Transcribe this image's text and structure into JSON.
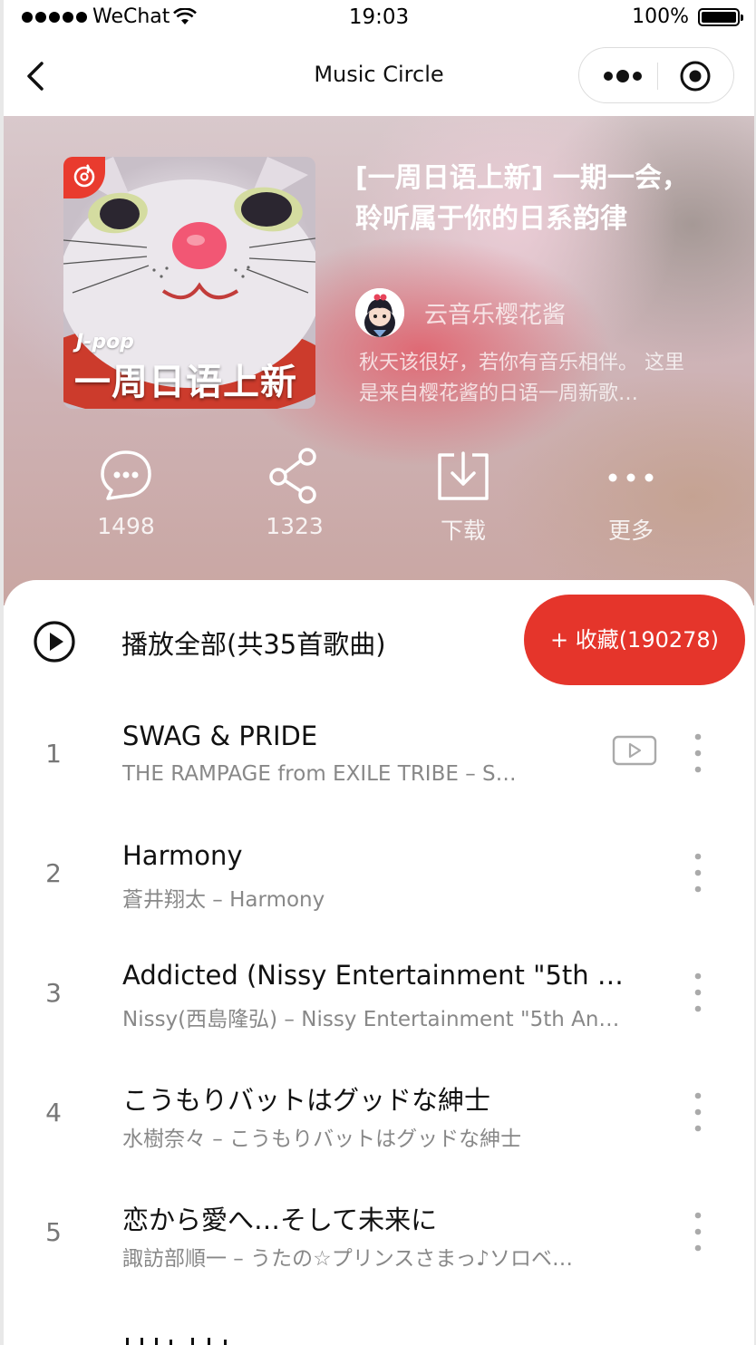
{
  "status_bar": {
    "carrier": "WeChat",
    "time": "19:03",
    "battery": "100%"
  },
  "nav": {
    "title": "Music Circle"
  },
  "playlist": {
    "cover_tag": "J-pop",
    "cover_title": "一周日语上新",
    "title": "[一周日语上新] 一期一会，聆听属于你的日系韵律",
    "creator": "云音乐樱花酱",
    "description": "秋天该很好，若你有音乐相伴。 这里是来自樱花酱的日语一周新歌…"
  },
  "actions": [
    {
      "icon": "comment-icon",
      "label": "1498"
    },
    {
      "icon": "share-icon",
      "label": "1323"
    },
    {
      "icon": "download-icon",
      "label": "下载"
    },
    {
      "icon": "more-icon",
      "label": "更多"
    }
  ],
  "play_all": {
    "label": "播放全部(共35首歌曲)",
    "collect_label": "+ 收藏(190278)"
  },
  "tracks": [
    {
      "num": "1",
      "title": "SWAG & PRIDE",
      "artist": "THE RAMPAGE from EXILE TRIBE – S…",
      "has_mv": true
    },
    {
      "num": "2",
      "title": "Harmony",
      "artist": "蒼井翔太 – Harmony",
      "has_mv": false
    },
    {
      "num": "3",
      "title": "Addicted (Nissy Entertainment \"5th …",
      "artist": "Nissy(西島隆弘) – Nissy Entertainment \"5th An…",
      "has_mv": false
    },
    {
      "num": "4",
      "title": "こうもりバットはグッドな紳士",
      "artist": "水樹奈々 – こうもりバットはグッドな紳士",
      "has_mv": false
    },
    {
      "num": "5",
      "title": "恋から愛へ…そして未来に",
      "artist": "諏訪部順一 – うたの☆プリンスさまっ♪ソロベ…",
      "has_mv": false
    }
  ],
  "colors": {
    "accent": "#e5352b",
    "primary_text": "#111111",
    "secondary_text": "#888888"
  }
}
